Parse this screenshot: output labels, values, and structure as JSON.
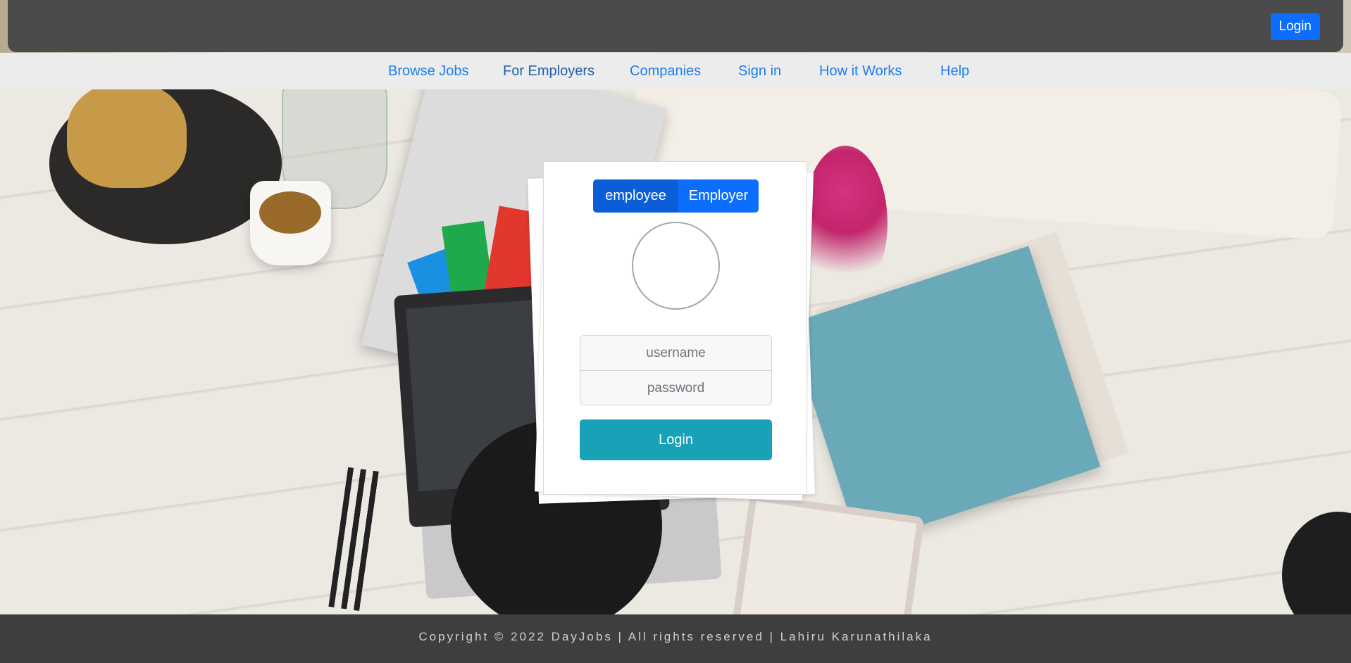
{
  "header": {
    "login_label": "Login"
  },
  "nav": {
    "items": [
      {
        "label": "Browse Jobs"
      },
      {
        "label": "For Employers"
      },
      {
        "label": "Companies"
      },
      {
        "label": "Sign in"
      },
      {
        "label": "How it Works"
      },
      {
        "label": "Help"
      }
    ]
  },
  "login_card": {
    "roles": {
      "employee": "employee",
      "employer": "Employer",
      "selected": "employee"
    },
    "username": {
      "value": "",
      "placeholder": "username"
    },
    "password": {
      "value": "",
      "placeholder": "password"
    },
    "submit_label": "Login"
  },
  "footer": {
    "text": "Copyright © 2022 DayJobs | All rights reserved | Lahiru Karunathilaka"
  },
  "colors": {
    "header_bg": "#4b4b4b",
    "primary": "#0d6efd",
    "primary_active": "#0b5ed7",
    "login_button": "#17a2b8",
    "nav_link": "#1d7ef0",
    "nav_bg": "#ececec",
    "footer_bg": "#3e3e3e"
  },
  "icons": {
    "avatar": "profile-image-placeholder"
  }
}
